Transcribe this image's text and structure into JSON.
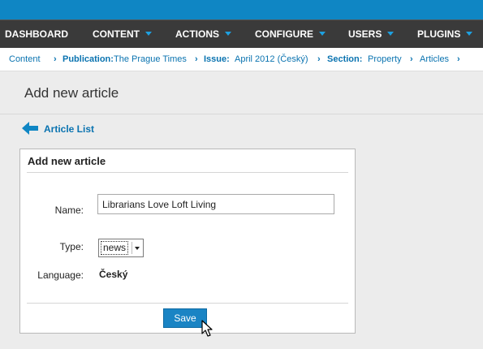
{
  "nav": {
    "items": [
      {
        "label": "DASHBOARD",
        "has_arrow": false
      },
      {
        "label": "CONTENT",
        "has_arrow": true
      },
      {
        "label": "ACTIONS",
        "has_arrow": true
      },
      {
        "label": "CONFIGURE",
        "has_arrow": true
      },
      {
        "label": "USERS",
        "has_arrow": true
      },
      {
        "label": "PLUGINS",
        "has_arrow": true
      }
    ]
  },
  "breadcrumb": {
    "content": "Content",
    "publication_label": "Publication:",
    "publication_value": "The Prague Times",
    "issue_label": "Issue:",
    "issue_value": "April 2012 (Český)",
    "section_label": "Section:",
    "section_value": "Property",
    "articles": "Articles",
    "separator": "›"
  },
  "page": {
    "title": "Add new article",
    "back_link": "Article List"
  },
  "form": {
    "panel_title": "Add new article",
    "name_label": "Name:",
    "name_value": "Librarians Love Loft Living",
    "type_label": "Type:",
    "type_value": "news",
    "language_label": "Language:",
    "language_value": "Český",
    "save_label": "Save"
  },
  "colors": {
    "accent": "#0f86c4",
    "nav_bg": "#3a3a3a",
    "link": "#0a73b0",
    "button": "#1a84c4"
  },
  "icons": {
    "back": "arrow-left-icon",
    "menu_caret": "caret-down-icon",
    "cursor": "mouse-pointer-icon"
  }
}
